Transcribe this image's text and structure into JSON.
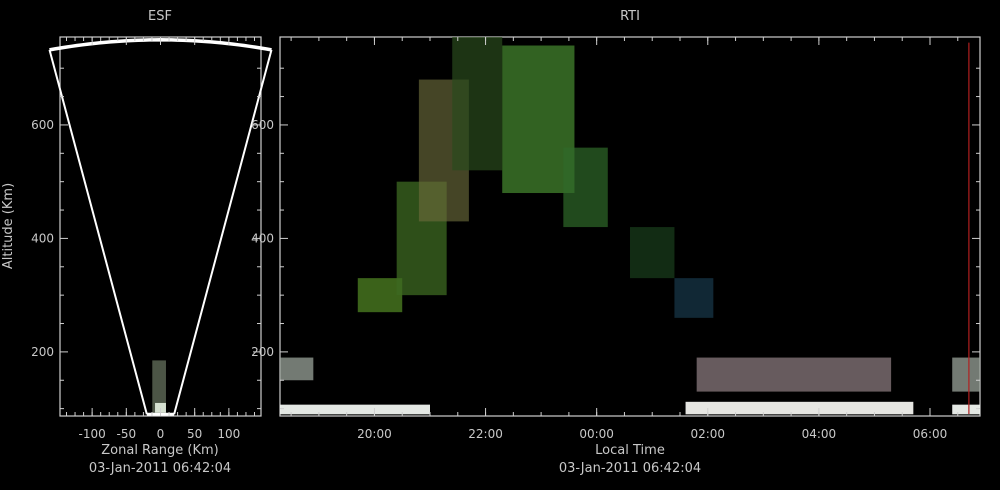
{
  "chart_data": [
    {
      "type": "heatmap",
      "title": "ESF",
      "xlabel": "Zonal Range (Km)",
      "ylabel": "Altitude (Km)",
      "xlim": [
        -147,
        147
      ],
      "ylim": [
        87,
        755
      ],
      "xticks": [
        -100,
        -50,
        0,
        50,
        100
      ],
      "xtick_labels": [
        "-100",
        "-50",
        "0",
        "50",
        "100"
      ],
      "yticks": [
        200,
        400,
        600
      ],
      "ytick_labels": [
        "200",
        "400",
        "600"
      ],
      "timestamp": "03-Jan-2011 06:42:04",
      "fan": {
        "half_angle_deg": 12.5,
        "max_range_km": 750,
        "min_alt_km": 90
      },
      "echo_regions": [
        {
          "x": [
            -12,
            8
          ],
          "alt": [
            90,
            185
          ],
          "color": "#8a9a80",
          "opacity": 0.55
        },
        {
          "x": [
            -8,
            8
          ],
          "alt": [
            93,
            110
          ],
          "color": "#dce8d8",
          "opacity": 0.95
        }
      ]
    },
    {
      "type": "heatmap",
      "title": "RTI",
      "xlabel": "Local Time",
      "ylabel": "",
      "xlim": [
        18.3,
        30.9
      ],
      "ylim": [
        87,
        755
      ],
      "xticks": [
        20,
        22,
        24,
        26,
        28,
        30
      ],
      "xtick_labels": [
        "20:00",
        "22:00",
        "00:00",
        "02:00",
        "04:00",
        "06:00"
      ],
      "yticks": [
        200,
        400,
        600
      ],
      "ytick_labels": [
        "200",
        "400",
        "600"
      ],
      "timestamp": "03-Jan-2011 06:42:04",
      "current_time_marker": 30.7,
      "marker_color": "#b02020",
      "echo_regions": [
        {
          "t": [
            18.3,
            18.9
          ],
          "alt": [
            150,
            190
          ],
          "color": "#9aa39a",
          "opacity": 0.75
        },
        {
          "t": [
            25.8,
            29.3
          ],
          "alt": [
            130,
            190
          ],
          "color": "#8a7a7e",
          "opacity": 0.75
        },
        {
          "t": [
            30.4,
            30.9
          ],
          "alt": [
            130,
            190
          ],
          "color": "#9aa39a",
          "opacity": 0.75
        },
        {
          "t": [
            18.3,
            21.0
          ],
          "alt": [
            90,
            107
          ],
          "color": "#f0f4f0",
          "opacity": 0.95
        },
        {
          "t": [
            25.6,
            29.7
          ],
          "alt": [
            90,
            112
          ],
          "color": "#f2f2ee",
          "opacity": 0.95
        },
        {
          "t": [
            30.4,
            30.9
          ],
          "alt": [
            90,
            107
          ],
          "color": "#f0f4f0",
          "opacity": 0.95
        },
        {
          "t": [
            19.7,
            20.5
          ],
          "alt": [
            270,
            330
          ],
          "color": "#4a7a20",
          "opacity": 0.8
        },
        {
          "t": [
            20.4,
            21.3
          ],
          "alt": [
            300,
            500
          ],
          "color": "#3e6a22",
          "opacity": 0.75
        },
        {
          "t": [
            20.8,
            21.7
          ],
          "alt": [
            430,
            680
          ],
          "color": "#6a6a3a",
          "opacity": 0.65
        },
        {
          "t": [
            21.4,
            22.3
          ],
          "alt": [
            520,
            755
          ],
          "color": "#2a4a1c",
          "opacity": 0.7
        },
        {
          "t": [
            22.3,
            23.6
          ],
          "alt": [
            480,
            740
          ],
          "color": "#3e7a2a",
          "opacity": 0.8
        },
        {
          "t": [
            23.4,
            24.2
          ],
          "alt": [
            420,
            560
          ],
          "color": "#2f6a2a",
          "opacity": 0.7
        },
        {
          "t": [
            24.6,
            25.4
          ],
          "alt": [
            330,
            420
          ],
          "color": "#1e4a22",
          "opacity": 0.6
        },
        {
          "t": [
            25.4,
            26.1
          ],
          "alt": [
            260,
            330
          ],
          "color": "#22506a",
          "opacity": 0.5
        }
      ]
    }
  ]
}
